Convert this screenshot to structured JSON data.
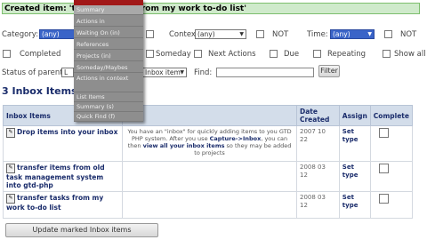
{
  "banner": {
    "text": "Created item: 'transfer tasks from my work to-do list'"
  },
  "filters": {
    "category_label": "Category:",
    "category_value": "(any)",
    "not_label": "NOT",
    "context_label": "Context:",
    "context_value": "(any)",
    "context_not_label": "NOT",
    "time_label": "Time:",
    "time_value": "(any)",
    "time_not_label": "NOT",
    "completed_label": "Completed",
    "someday_label": "Someday",
    "next_actions_label": "Next Actions",
    "due_label": "Due",
    "repeating_label": "Repeating",
    "show_all_label": "Show all",
    "status_parent_label": "Status of parent:",
    "status_parent_value": "L",
    "type_value": "Inbox item",
    "find_label": "Find:",
    "filter_button": "Filter"
  },
  "list": {
    "heading": "3 Inbox Items",
    "columns": [
      "Inbox Items",
      "",
      "Date Created",
      "Assign",
      "Complete"
    ],
    "rows": [
      {
        "title": "Drop items into your inbox",
        "desc_pre": "You have an \"inbox\" for quickly adding items to you GTD PHP system. After you use ",
        "desc_b1": "Capture->Inbox",
        "desc_mid": ", you can then ",
        "desc_b2": "view all your inbox items",
        "desc_post": " so they may be added to projects",
        "date1": "2007 10",
        "date2": "22",
        "assign1": "Set",
        "assign2": "type"
      },
      {
        "title": "transfer items from old task management system into gtd-php",
        "date1": "2008 03",
        "date2": "12",
        "assign1": "Set",
        "assign2": "type"
      },
      {
        "title": "transfer tasks from my work to-do list",
        "date1": "2008 03",
        "date2": "12",
        "assign1": "Set",
        "assign2": "type"
      }
    ],
    "update_button": "Update marked Inbox items"
  },
  "menu": {
    "items": [
      "Summary",
      "Actions in",
      "Waiting On (in)",
      "References",
      "Projects (in)",
      "Someday/Maybes",
      "Actions in context",
      "List Items",
      "Summary (s)",
      "Quick Find (f)"
    ]
  }
}
